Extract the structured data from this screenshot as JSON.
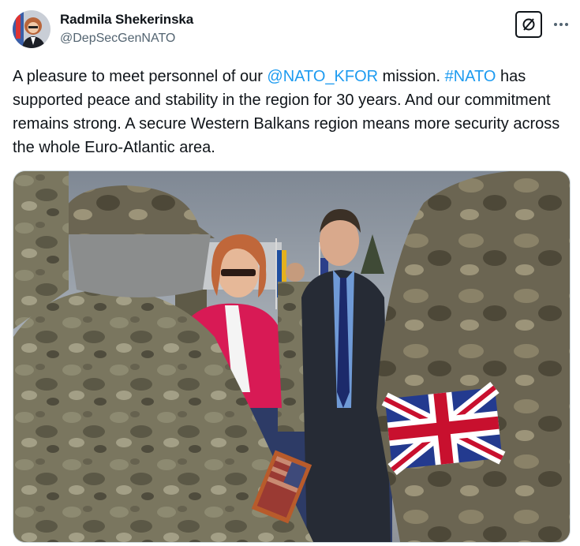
{
  "author": {
    "name": "Radmila Shekerinska",
    "handle": "@DepSecGenNATO",
    "avatar_icon": "avatar-photo"
  },
  "actions": {
    "grok_icon": "grok-icon",
    "more_icon": "more-options-icon"
  },
  "tweet": {
    "segments": [
      {
        "text": "A pleasure to meet personnel of our ",
        "link": false
      },
      {
        "text": "@NATO_KFOR",
        "link": true
      },
      {
        "text": " mission. ",
        "link": false
      },
      {
        "text": "#NATO",
        "link": true
      },
      {
        "text": " has supported peace and stability in the region for 30 years. And our commitment remains strong. A secure Western Balkans region means more security across the whole Euro-Atlantic area.",
        "link": false
      }
    ]
  },
  "media": {
    "type": "photo",
    "colors": {
      "sky": "#9aa3ab",
      "camo": "#6f6a55",
      "jacket_pink": "#d81a55",
      "suit": "#2a2f3a"
    }
  },
  "colors": {
    "text": "#0f1419",
    "secondary": "#536471",
    "link": "#1d9bf0"
  }
}
